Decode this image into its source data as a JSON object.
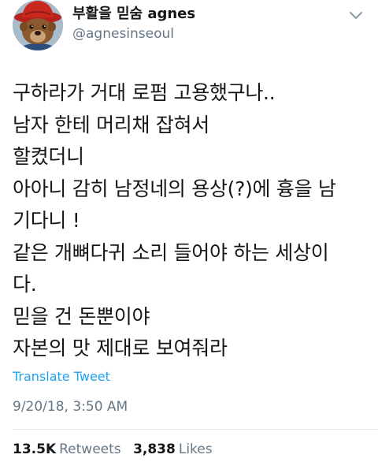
{
  "user": {
    "display_name": "부활을 믿숨 agnes",
    "handle": "@agnesinseoul",
    "avatar_icon": "bear-avatar-icon"
  },
  "menu": {
    "icon": "chevron-down-icon"
  },
  "tweet": {
    "lines": [
      "구하라가 거대 로펌 고용했구나..",
      "남자 한테 머리채 잡혀서",
      "할켰더니",
      "아아니 감히 남정네의 용상(?)에 흉을 남",
      "기다니 !",
      "같은 개뼈다귀 소리 들어야 하는 세상이",
      "다.",
      "믿을 건 돈뿐이야",
      "자본의 맛 제대로 보여줘라"
    ],
    "translate_label": "Translate Tweet",
    "timestamp": "9/20/18, 3:50 AM"
  },
  "stats": {
    "retweets_count": "13.5K",
    "retweets_label": "Retweets",
    "likes_count": "3,838",
    "likes_label": "Likes"
  },
  "colors": {
    "link": "#1da1f2",
    "secondary_text": "#657786",
    "primary_text": "#14171a",
    "divider": "#e1e8ed"
  }
}
